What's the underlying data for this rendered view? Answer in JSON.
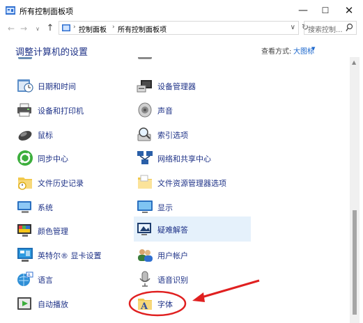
{
  "window": {
    "title": "所有控制面板项",
    "controls": {
      "minimize": "—",
      "maximize": "☐",
      "close": "✕"
    }
  },
  "address_bar": {
    "segments": [
      "控制面板",
      "所有控制面板项"
    ],
    "separator": "›",
    "dropdown": "∨",
    "refresh": "↻"
  },
  "search": {
    "placeholder": "搜索控制..."
  },
  "header": {
    "title": "调整计算机的设置",
    "view_by_label": "查看方式:",
    "view_by_value": "大图标"
  },
  "items": {
    "left": [
      {
        "label": "日期和时间",
        "icon": "clock-icon"
      },
      {
        "label": "设备和打印机",
        "icon": "printer-icon"
      },
      {
        "label": "鼠标",
        "icon": "mouse-icon"
      },
      {
        "label": "同步中心",
        "icon": "sync-icon"
      },
      {
        "label": "文件历史记录",
        "icon": "file-history-icon"
      },
      {
        "label": "系统",
        "icon": "computer-icon"
      },
      {
        "label": "颜色管理",
        "icon": "color-management-icon"
      },
      {
        "label": "英特尔® 显卡设置",
        "icon": "intel-graphics-icon"
      },
      {
        "label": "语言",
        "icon": "language-icon"
      },
      {
        "label": "自动播放",
        "icon": "autoplay-icon"
      }
    ],
    "right": [
      {
        "label": "设备管理器",
        "icon": "device-manager-icon"
      },
      {
        "label": "声音",
        "icon": "speaker-icon"
      },
      {
        "label": "索引选项",
        "icon": "indexing-icon"
      },
      {
        "label": "网络和共享中心",
        "icon": "network-icon"
      },
      {
        "label": "文件资源管理器选项",
        "icon": "folder-options-icon"
      },
      {
        "label": "显示",
        "icon": "monitor-icon"
      },
      {
        "label": "疑难解答",
        "icon": "troubleshoot-icon",
        "highlighted": true
      },
      {
        "label": "用户帐户",
        "icon": "users-icon"
      },
      {
        "label": "语音识别",
        "icon": "microphone-icon"
      },
      {
        "label": "字体",
        "icon": "fonts-icon",
        "annotated": true
      }
    ]
  },
  "colors": {
    "link": "#1e3287",
    "hover_bg": "#e5f1fb",
    "annotation": "#e02020",
    "view_value": "#1a66cc"
  }
}
